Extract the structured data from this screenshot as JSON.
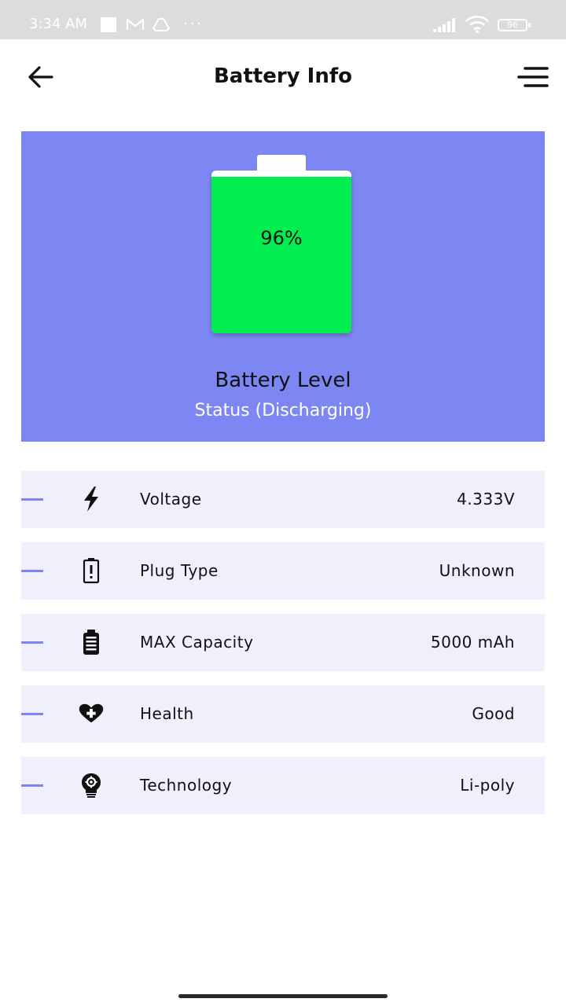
{
  "status_bar": {
    "time": "3:34 AM",
    "battery_level": "96",
    "icons": [
      "gmail-icon",
      "drive-icon",
      "more-dots-icon",
      "signal-icon",
      "wifi-icon",
      "battery-icon"
    ],
    "more": "···"
  },
  "app_bar": {
    "title": "Battery Info",
    "back_icon": "arrow-left-icon",
    "menu_icon": "hamburger-menu-icon"
  },
  "hero": {
    "percentage_text": "96%",
    "percentage_value": 96,
    "label": "Battery Level",
    "status": "Status (Discharging)",
    "background_color": "#7d87f3",
    "fill_color": "#00ee50"
  },
  "rows": [
    {
      "icon": "lightning-bolt-icon",
      "label": "Voltage",
      "value": "4.333V"
    },
    {
      "icon": "plug-alert-icon",
      "label": "Plug Type",
      "value": "Unknown"
    },
    {
      "icon": "battery-capacity-icon",
      "label": "MAX Capacity",
      "value": "5000 mAh"
    },
    {
      "icon": "heart-plus-icon",
      "label": "Health",
      "value": "Good"
    },
    {
      "icon": "lightbulb-gear-icon",
      "label": "Technology",
      "value": "Li-poly"
    }
  ],
  "colors": {
    "accent": "#7d87f3",
    "row_background": "#f0f0fd",
    "status_bar": "#dcdcdc"
  }
}
